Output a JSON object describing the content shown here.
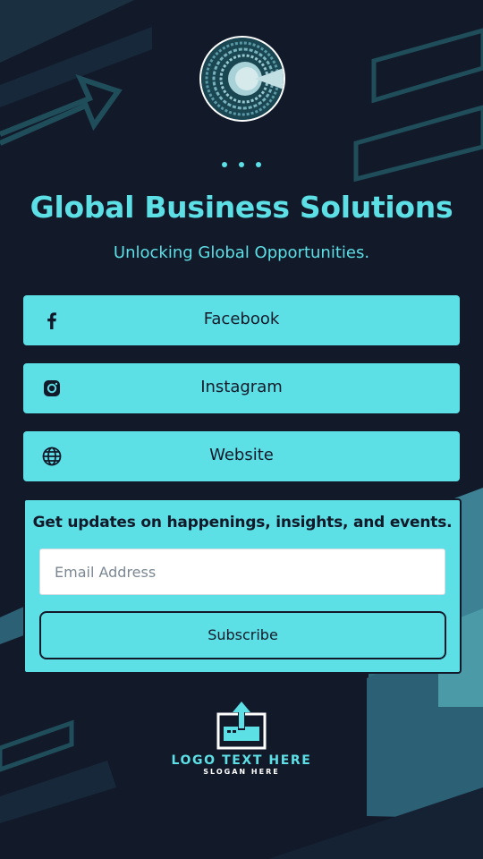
{
  "profile": {
    "title": "Global Business Solutions",
    "subtitle": "Unlocking Global Opportunities."
  },
  "links": [
    {
      "label": "Facebook",
      "icon": "facebook-icon"
    },
    {
      "label": "Instagram",
      "icon": "instagram-icon"
    },
    {
      "label": "Website",
      "icon": "globe-icon"
    }
  ],
  "newsletter": {
    "heading": "Get updates on happenings, insights, and events.",
    "email_placeholder": "Email Address",
    "email_value": "",
    "subscribe_label": "Subscribe"
  },
  "logo": {
    "text": "LOGO TEXT HERE",
    "slogan": "SLOGAN HERE"
  },
  "colors": {
    "background": "#121a2a",
    "accent": "#5ddfe6",
    "deco": "#1f4d5a",
    "text_dark": "#121a2a"
  }
}
